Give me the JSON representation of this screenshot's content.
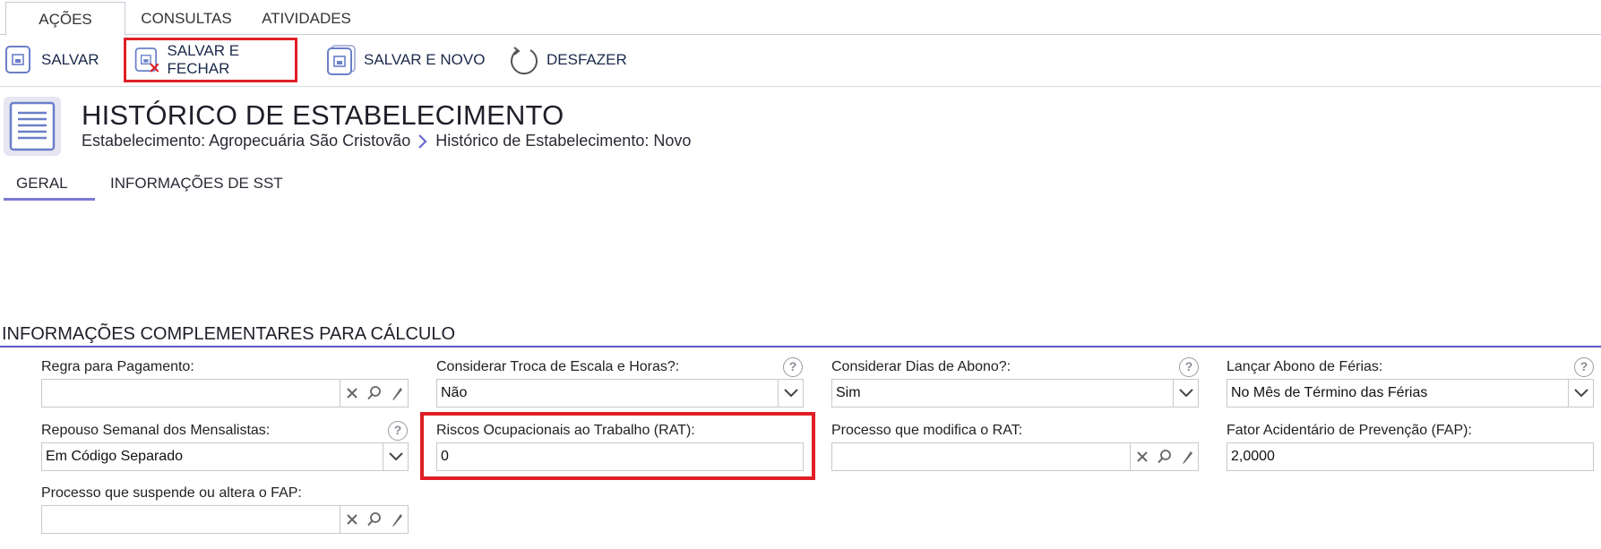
{
  "top_tabs": {
    "acoes": "AÇÕES",
    "consultas": "CONSULTAS",
    "atividades": "ATIVIDADES"
  },
  "toolbar": {
    "salvar": "SALVAR",
    "salvar_fechar": "SALVAR E FECHAR",
    "salvar_novo": "SALVAR E NOVO",
    "desfazer": "DESFAZER"
  },
  "header": {
    "title": "HISTÓRICO DE ESTABELECIMENTO",
    "breadcrumb_parent": "Estabelecimento: Agropecuária São Cristovão",
    "breadcrumb_current": "Histórico de Estabelecimento: Novo"
  },
  "content_tabs": {
    "geral": "GERAL",
    "sst": "INFORMAÇÕES DE SST"
  },
  "section": {
    "title": "INFORMAÇÕES COMPLEMENTARES PARA CÁLCULO"
  },
  "fields": {
    "regra_pagamento": {
      "label": "Regra para Pagamento:",
      "value": ""
    },
    "troca_escala": {
      "label": "Considerar Troca de Escala e Horas?:",
      "value": "Não"
    },
    "dias_abono": {
      "label": "Considerar Dias de Abono?:",
      "value": "Sim"
    },
    "abono_ferias": {
      "label": "Lançar Abono de Férias:",
      "value": "No Mês de Término das Férias"
    },
    "repouso_semanal": {
      "label": "Repouso Semanal dos Mensalistas:",
      "value": "Em Código Separado"
    },
    "rat": {
      "label": "Riscos Ocupacionais ao Trabalho (RAT):",
      "value": "0"
    },
    "processo_rat": {
      "label": "Processo que modifica o RAT:",
      "value": ""
    },
    "fap": {
      "label": "Fator Acidentário de Prevenção (FAP):",
      "value": "2,0000"
    },
    "processo_fap": {
      "label": "Processo que suspende ou altera o FAP:",
      "value": ""
    }
  },
  "help_glyph": "?",
  "colors": {
    "accent": "#5a5ac8",
    "highlight": "#e01f26",
    "icon_blue": "#6a7fc8"
  },
  "icons": [
    "save-icon",
    "save-close-icon",
    "save-new-icon",
    "undo-icon",
    "document-list-icon",
    "clear-icon",
    "search-icon",
    "edit-icon",
    "chevron-down-icon",
    "help-icon"
  ]
}
